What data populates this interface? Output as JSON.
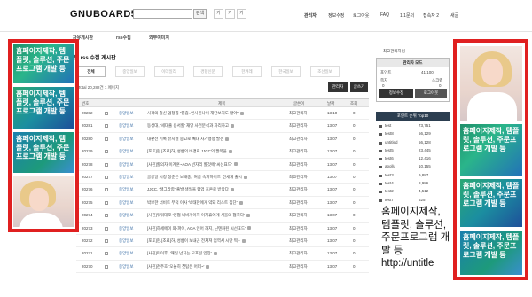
{
  "header": {
    "logo": "GNUBOARD5",
    "search_button": "검색",
    "font_buttons": [
      "가",
      "가",
      "가"
    ],
    "menu": [
      "관리자",
      "정보수정",
      "로그아웃",
      "FAQ",
      "1:1문의",
      "접속자 2",
      "새글"
    ]
  },
  "nav": {
    "items": [
      "자유게시판",
      "rss수집",
      "외부이미지"
    ]
  },
  "board": {
    "title": "수동 rss 수집 게시판",
    "tabs": [
      "전체",
      "중앙일보",
      "이데일리",
      "경향신문",
      "한겨레",
      "한국일보",
      "조선일보"
    ],
    "total": "Total 20,282건 1 페이지",
    "admin_button": "관리자",
    "write_button": "글쓰기",
    "columns": [
      "번호",
      "",
      "제목",
      "글쓴이",
      "날짜",
      "조회"
    ],
    "rows": [
      {
        "num": "20282",
        "cat": "중앙일보",
        "subject": "사각의 출신 엄청힘 \"힘쥼..인사원나이 재단보지도 많아\"",
        "writer": "최고관리자",
        "date": "13:10",
        "views": "0"
      },
      {
        "num": "20281",
        "cat": "중앙일보",
        "subject": "동생대, '세대출 용서할' 재앙 사전분석과 자리하고",
        "writer": "최고관리자",
        "date": "13:07",
        "views": "0"
      },
      {
        "num": "20280",
        "cat": "중앙일보",
        "subject": "대판전 기록 뮤지컬 중고로 빼대 사기행정 발견",
        "writer": "최고관리자",
        "date": "13:07",
        "views": "0"
      },
      {
        "num": "20279",
        "cat": "중앙일보",
        "subject": "[포토]현.[조료]하, 성륭의 비경로 JJCC의 팔목을",
        "writer": "최고관리자",
        "date": "13:07",
        "views": "0"
      },
      {
        "num": "20278",
        "cat": "중앙일보",
        "subject": "[사진]할의자 이계훈~AOA 빈자리 할것에 '씨선표드'",
        "writer": "최고관리자",
        "date": "13:07",
        "views": "0"
      },
      {
        "num": "20277",
        "cat": "중앙일보",
        "subject": "골공일 시청 청춘은 보때중, '여름 속피하이드' 전세계 출시",
        "writer": "최고관리자",
        "date": "13:07",
        "views": "0"
      },
      {
        "num": "20276",
        "cat": "중앙일보",
        "subject": "JJCC, '생그라함' 출발 생일을 했었 호온로 받았다",
        "writer": "최고관리자",
        "date": "13:07",
        "views": "0"
      },
      {
        "num": "20275",
        "cat": "중앙일보",
        "subject": "박보한 너비트 무덕 이사 '박태한에게 약돼 리스트 집단'",
        "writer": "최고관리자",
        "date": "13:07",
        "views": "0"
      },
      {
        "num": "20274",
        "cat": "중앙일보",
        "subject": "[사진]워워대로 '잉험 네비게이지 이제휴에게 서울의 험하다'",
        "writer": "최고관리자",
        "date": "13:07",
        "views": "0"
      },
      {
        "num": "20273",
        "cat": "중앙일보",
        "subject": "[사진]하세에이 와-파이, AOA 인어 까지, 닌텐화된 씨선표드'",
        "writer": "최고관리자",
        "date": "13:07",
        "views": "0"
      },
      {
        "num": "20272",
        "cat": "중앙일보",
        "subject": "[포토]현.[조료]하, 성륭이 보내곤 전쳐져 엄역서 시만 찍~",
        "writer": "최고관리자",
        "date": "13:07",
        "views": "0"
      },
      {
        "num": "20271",
        "cat": "중앙일보",
        "subject": "[사진]미이후, '깨일 넘치는 모프일 입장'",
        "writer": "최고관리자",
        "date": "13:07",
        "views": "0"
      },
      {
        "num": "20270",
        "cat": "중앙일보",
        "subject": "[사진]천주호 '오늘히 첫탐은 어떠~'",
        "writer": "최고관리자",
        "date": "13:07",
        "views": "0"
      }
    ]
  },
  "sidebar": {
    "admin_label": "최고관리자님",
    "box_title": "관리자 모드",
    "points_label": "포인트",
    "points_value": "41,100",
    "memo_label": "쪽지",
    "memo_value": "0",
    "scrap_label": "스크랩",
    "scrap_value": "0",
    "info_button": "정보수정",
    "logout_button": "로그아웃",
    "rank_title": "포인트 순위 Top10",
    "ranks": [
      {
        "rank": "1",
        "name": "test",
        "points": "73,751"
      },
      {
        "rank": "2",
        "name": "test8",
        "points": "56,129"
      },
      {
        "rank": "3",
        "name": "untitled",
        "points": "56,128"
      },
      {
        "rank": "4",
        "name": "test5",
        "points": "23,445"
      },
      {
        "rank": "5",
        "name": "test6",
        "points": "12,416"
      },
      {
        "rank": "6",
        "name": "apollu",
        "points": "10,155"
      },
      {
        "rank": "7",
        "name": "test3",
        "points": "9,887"
      },
      {
        "rank": "8",
        "name": "test4",
        "points": "8,986"
      },
      {
        "rank": "9",
        "name": "test2",
        "points": "4,512"
      },
      {
        "rank": "10",
        "name": "test7",
        "points": "525"
      }
    ]
  },
  "ads": {
    "left_tiles": [
      "홈페이지제작, 템플릿, 솔루션, 주문프로그램 개발 등",
      "홈페이지제작, 템플릿, 솔루션, 주문프로그램 개발 등",
      "홈페이지제작, 템플릿, 솔루션, 주문프로그램 개발 등"
    ],
    "right_tiles": [
      "홈페이지제작, 템플릿, 솔루션, 주문프로그램 개발 등",
      "홈페이지제작, 템플릿, 솔루션, 주문프로그램 개발 등",
      "홈페이지제작, 템플릿, 솔루션, 주문프로그램 개발 등"
    ],
    "big_text": "홈페이지제작, 템플릿, 솔루션, 주문프로그램 개발 등 http://untitle",
    "frame_color": "#e02020"
  }
}
